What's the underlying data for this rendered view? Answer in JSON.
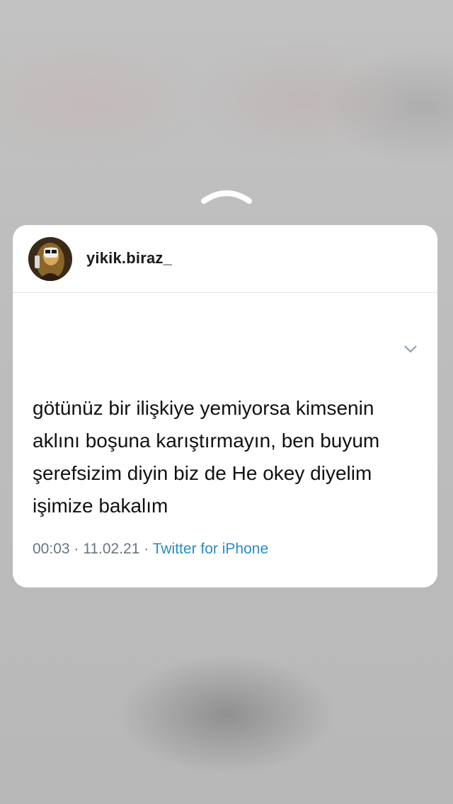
{
  "story": {
    "swipe_up_icon": "chevron-up-icon"
  },
  "post": {
    "username": "yikik.biraz_",
    "avatar_icon": "profile-avatar",
    "tweet": {
      "lines": [
        "götünüz bir ilişkiye yemiyorsa kimsenin",
        "aklını boşuna karıştırmayın, ben buyum",
        "şerefsizim diyin biz de He okey diyelim",
        "işimize bakalım"
      ],
      "time": "00:03",
      "separator": " · ",
      "date": "11.02.21",
      "source": "Twitter for iPhone",
      "more_icon": "chevron-down-icon"
    }
  },
  "colors": {
    "link": "#2c8bc4",
    "meta": "#687684"
  }
}
